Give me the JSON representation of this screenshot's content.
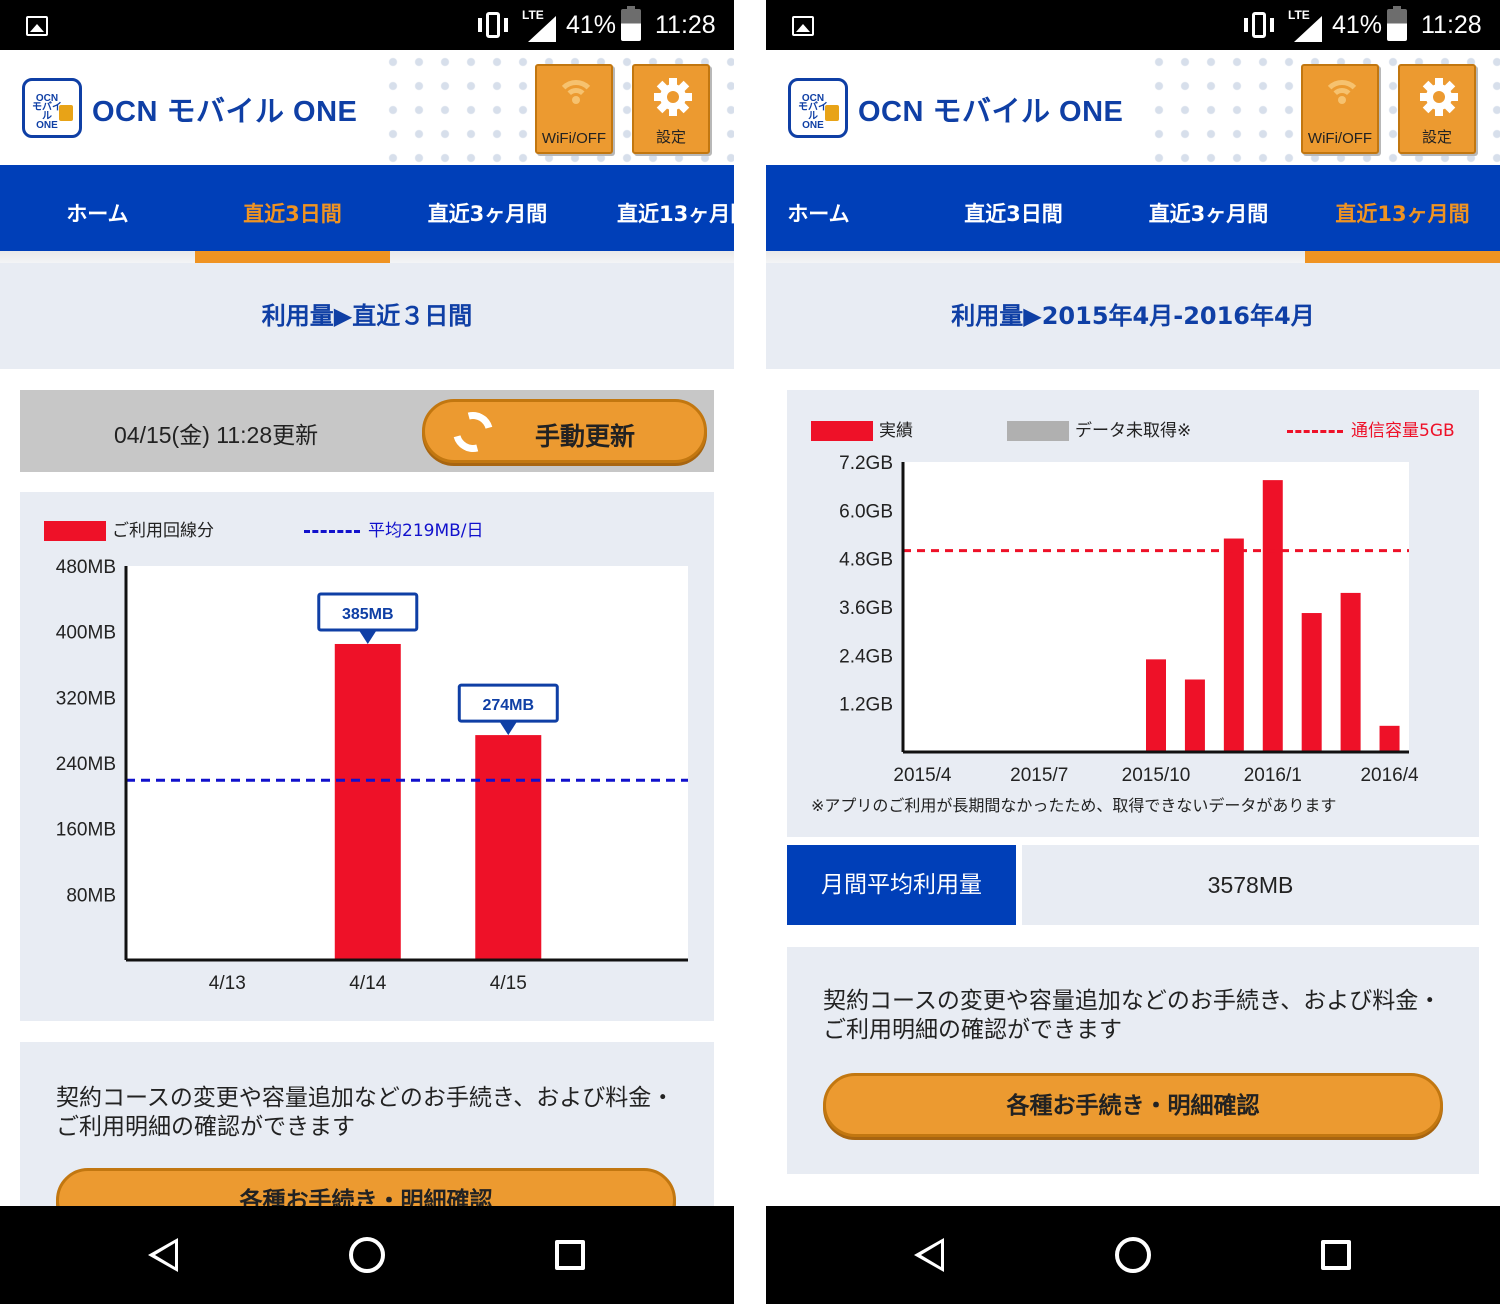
{
  "status_bar": {
    "battery": "41%",
    "time": "11:28",
    "network": "LTE"
  },
  "header": {
    "logo_small": "OCN モバイル ONE",
    "title": "OCN モバイル ONE",
    "wifi_label": "WiFi/OFF",
    "settings_label": "設定"
  },
  "tabs": [
    "ホーム",
    "直近3日間",
    "直近3ヶ月間",
    "直近13ヶ月間"
  ],
  "screen_left": {
    "breadcrumb": "利用量▶直近３日間",
    "updated": "04/15(金) 11:28更新",
    "refresh_button": "手動更新",
    "legend_usage": "ご利用回線分",
    "legend_avg": "平均219MB/日",
    "info_text": "契約コースの変更や容量追加などのお手続き、および料金・ご利用明細の確認ができます",
    "procedures_button": "各種お手続き・明細確認"
  },
  "screen_right": {
    "breadcrumb": "利用量▶2015年4月-2016年4月",
    "legend_actual": "実績",
    "legend_missing": "データ未取得※",
    "legend_cap": "通信容量5GB",
    "note": "※アプリのご利用が長期間なかったため、取得できないデータがあります",
    "avg_label": "月間平均利用量",
    "avg_value": "3578MB",
    "info_text": "契約コースの変更や容量追加などのお手続き、および料金・ご利用明細の確認ができます",
    "procedures_button": "各種お手続き・明細確認"
  },
  "chart_data": [
    {
      "type": "bar",
      "categories": [
        "4/13",
        "4/14",
        "4/15"
      ],
      "values": [
        0,
        385,
        274
      ],
      "data_labels": [
        "",
        "385MB",
        "274MB"
      ],
      "y_ticks": [
        "80MB",
        "160MB",
        "240MB",
        "320MB",
        "400MB",
        "480MB"
      ],
      "ylim": [
        0,
        480
      ],
      "reference_line": 219,
      "bar_color": "#ee1128",
      "reference_color": "#1111cc"
    },
    {
      "type": "bar",
      "x_ticks": [
        "2015/4",
        "2015/7",
        "2015/10",
        "2016/1",
        "2016/4"
      ],
      "categories": [
        "2015/4",
        "2015/5",
        "2015/6",
        "2015/7",
        "2015/8",
        "2015/9",
        "2015/10",
        "2015/11",
        "2015/12",
        "2016/1",
        "2016/2",
        "2016/3",
        "2016/4"
      ],
      "values": [
        0,
        0,
        0,
        0,
        0,
        0,
        2.3,
        1.8,
        5.3,
        6.75,
        3.45,
        3.95,
        0.65
      ],
      "y_ticks": [
        "1.2GB",
        "2.4GB",
        "3.6GB",
        "4.8GB",
        "6.0GB",
        "7.2GB"
      ],
      "ylim": [
        0,
        7.2
      ],
      "reference_line": 5.0,
      "bar_color": "#ee1128",
      "reference_color": "#ee1128"
    }
  ]
}
